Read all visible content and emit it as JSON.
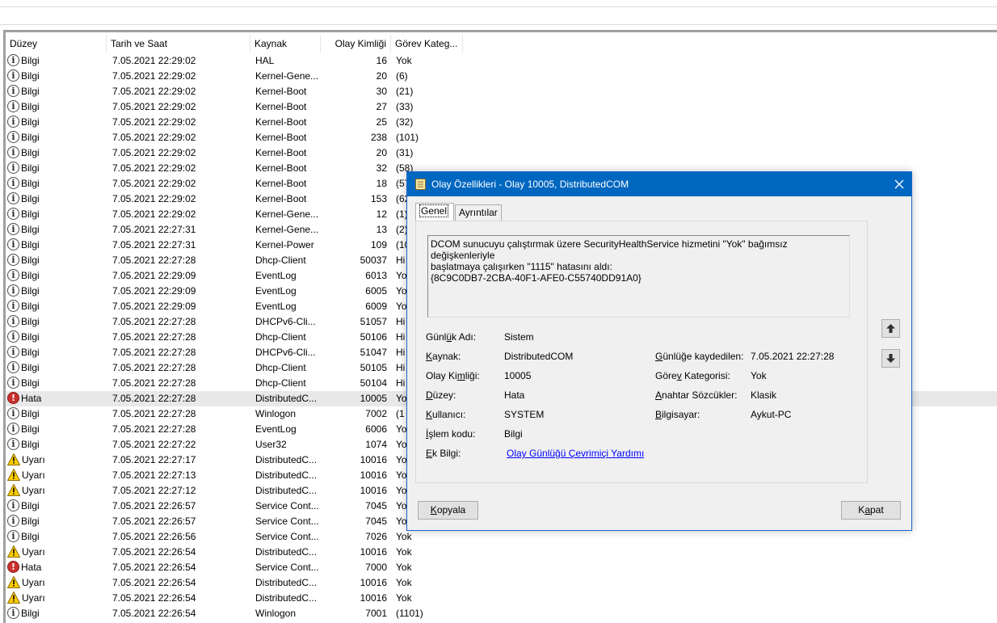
{
  "columns": {
    "level": "Düzey",
    "datetime": "Tarih ve Saat",
    "source": "Kaynak",
    "event_id": "Olay Kimliği",
    "category": "Görev Kateg..."
  },
  "events": [
    {
      "level": "Bilgi",
      "type": "info",
      "datetime": "7.05.2021 22:29:02",
      "source": "HAL",
      "id": "16",
      "category": "Yok"
    },
    {
      "level": "Bilgi",
      "type": "info",
      "datetime": "7.05.2021 22:29:02",
      "source": "Kernel-Gene...",
      "id": "20",
      "category": "(6)"
    },
    {
      "level": "Bilgi",
      "type": "info",
      "datetime": "7.05.2021 22:29:02",
      "source": "Kernel-Boot",
      "id": "30",
      "category": "(21)"
    },
    {
      "level": "Bilgi",
      "type": "info",
      "datetime": "7.05.2021 22:29:02",
      "source": "Kernel-Boot",
      "id": "27",
      "category": "(33)"
    },
    {
      "level": "Bilgi",
      "type": "info",
      "datetime": "7.05.2021 22:29:02",
      "source": "Kernel-Boot",
      "id": "25",
      "category": "(32)"
    },
    {
      "level": "Bilgi",
      "type": "info",
      "datetime": "7.05.2021 22:29:02",
      "source": "Kernel-Boot",
      "id": "238",
      "category": "(101)"
    },
    {
      "level": "Bilgi",
      "type": "info",
      "datetime": "7.05.2021 22:29:02",
      "source": "Kernel-Boot",
      "id": "20",
      "category": "(31)"
    },
    {
      "level": "Bilgi",
      "type": "info",
      "datetime": "7.05.2021 22:29:02",
      "source": "Kernel-Boot",
      "id": "32",
      "category": "(58)"
    },
    {
      "level": "Bilgi",
      "type": "info",
      "datetime": "7.05.2021 22:29:02",
      "source": "Kernel-Boot",
      "id": "18",
      "category": "(57"
    },
    {
      "level": "Bilgi",
      "type": "info",
      "datetime": "7.05.2021 22:29:02",
      "source": "Kernel-Boot",
      "id": "153",
      "category": "(62"
    },
    {
      "level": "Bilgi",
      "type": "info",
      "datetime": "7.05.2021 22:29:02",
      "source": "Kernel-Gene...",
      "id": "12",
      "category": "(1)"
    },
    {
      "level": "Bilgi",
      "type": "info",
      "datetime": "7.05.2021 22:27:31",
      "source": "Kernel-Gene...",
      "id": "13",
      "category": "(2)"
    },
    {
      "level": "Bilgi",
      "type": "info",
      "datetime": "7.05.2021 22:27:31",
      "source": "Kernel-Power",
      "id": "109",
      "category": "(10"
    },
    {
      "level": "Bilgi",
      "type": "info",
      "datetime": "7.05.2021 22:27:28",
      "source": "Dhcp-Client",
      "id": "50037",
      "category": "Hi"
    },
    {
      "level": "Bilgi",
      "type": "info",
      "datetime": "7.05.2021 22:29:09",
      "source": "EventLog",
      "id": "6013",
      "category": "Yo"
    },
    {
      "level": "Bilgi",
      "type": "info",
      "datetime": "7.05.2021 22:29:09",
      "source": "EventLog",
      "id": "6005",
      "category": "Yo"
    },
    {
      "level": "Bilgi",
      "type": "info",
      "datetime": "7.05.2021 22:29:09",
      "source": "EventLog",
      "id": "6009",
      "category": "Yo"
    },
    {
      "level": "Bilgi",
      "type": "info",
      "datetime": "7.05.2021 22:27:28",
      "source": "DHCPv6-Cli...",
      "id": "51057",
      "category": "Hi"
    },
    {
      "level": "Bilgi",
      "type": "info",
      "datetime": "7.05.2021 22:27:28",
      "source": "Dhcp-Client",
      "id": "50106",
      "category": "Hi"
    },
    {
      "level": "Bilgi",
      "type": "info",
      "datetime": "7.05.2021 22:27:28",
      "source": "DHCPv6-Cli...",
      "id": "51047",
      "category": "Hi"
    },
    {
      "level": "Bilgi",
      "type": "info",
      "datetime": "7.05.2021 22:27:28",
      "source": "Dhcp-Client",
      "id": "50105",
      "category": "Hi"
    },
    {
      "level": "Bilgi",
      "type": "info",
      "datetime": "7.05.2021 22:27:28",
      "source": "Dhcp-Client",
      "id": "50104",
      "category": "Hi"
    },
    {
      "level": "Hata",
      "type": "error",
      "datetime": "7.05.2021 22:27:28",
      "source": "DistributedC...",
      "id": "10005",
      "category": "Yo",
      "selected": true
    },
    {
      "level": "Bilgi",
      "type": "info",
      "datetime": "7.05.2021 22:27:28",
      "source": "Winlogon",
      "id": "7002",
      "category": "(1"
    },
    {
      "level": "Bilgi",
      "type": "info",
      "datetime": "7.05.2021 22:27:28",
      "source": "EventLog",
      "id": "6006",
      "category": "Yo"
    },
    {
      "level": "Bilgi",
      "type": "info",
      "datetime": "7.05.2021 22:27:22",
      "source": "User32",
      "id": "1074",
      "category": "Yo"
    },
    {
      "level": "Uyarı",
      "type": "warning",
      "datetime": "7.05.2021 22:27:17",
      "source": "DistributedC...",
      "id": "10016",
      "category": "Yo"
    },
    {
      "level": "Uyarı",
      "type": "warning",
      "datetime": "7.05.2021 22:27:13",
      "source": "DistributedC...",
      "id": "10016",
      "category": "Yo"
    },
    {
      "level": "Uyarı",
      "type": "warning",
      "datetime": "7.05.2021 22:27:12",
      "source": "DistributedC...",
      "id": "10016",
      "category": "Yo"
    },
    {
      "level": "Bilgi",
      "type": "info",
      "datetime": "7.05.2021 22:26:57",
      "source": "Service Cont...",
      "id": "7045",
      "category": "Yo"
    },
    {
      "level": "Bilgi",
      "type": "info",
      "datetime": "7.05.2021 22:26:57",
      "source": "Service Cont...",
      "id": "7045",
      "category": "Yo"
    },
    {
      "level": "Bilgi",
      "type": "info",
      "datetime": "7.05.2021 22:26:56",
      "source": "Service Cont...",
      "id": "7026",
      "category": "Yok"
    },
    {
      "level": "Uyarı",
      "type": "warning",
      "datetime": "7.05.2021 22:26:54",
      "source": "DistributedC...",
      "id": "10016",
      "category": "Yok"
    },
    {
      "level": "Hata",
      "type": "error",
      "datetime": "7.05.2021 22:26:54",
      "source": "Service Cont...",
      "id": "7000",
      "category": "Yok"
    },
    {
      "level": "Uyarı",
      "type": "warning",
      "datetime": "7.05.2021 22:26:54",
      "source": "DistributedC...",
      "id": "10016",
      "category": "Yok"
    },
    {
      "level": "Uyarı",
      "type": "warning",
      "datetime": "7.05.2021 22:26:54",
      "source": "DistributedC...",
      "id": "10016",
      "category": "Yok"
    },
    {
      "level": "Bilgi",
      "type": "info",
      "datetime": "7.05.2021 22:26:54",
      "source": "Winlogon",
      "id": "7001",
      "category": "(1101)"
    }
  ],
  "dialog": {
    "title": "Olay Özellikleri - Olay 10005, DistributedCOM",
    "tabs": [
      "Genel",
      "Ayrıntılar"
    ],
    "description": "DCOM sunucuyu çalıştırmak üzere SecurityHealthService hizmetini \"Yok\" bağımsız değişkenleriyle\nbaşlatmaya çalışırken \"1115\" hatasını aldı:\n{8C9C0DB7-2CBA-40F1-AFE0-C55740DD91A0}",
    "labels": {
      "log_name": "Günlük Adı:",
      "source": "Kaynak:",
      "event_id": "Olay Kimliği:",
      "level": "Düzey:",
      "user": "Kullanıcı:",
      "opcode": "İşlem kodu:",
      "more_info": "Ek Bilgi:",
      "logged": "Günlüğe kaydedilen:",
      "task_category": "Görev Kategorisi:",
      "keywords": "Anahtar Sözcükler:",
      "computer": "Bilgisayar:"
    },
    "values": {
      "log_name": "Sistem",
      "source": "DistributedCOM",
      "event_id": "10005",
      "level": "Hata",
      "user": "SYSTEM",
      "opcode": "Bilgi",
      "more_info_link": "Olay Günlüğü Çevrimiçi Yardımı",
      "logged": "7.05.2021 22:27:28",
      "task_category": "Yok",
      "keywords": "Klasik",
      "computer": "Aykut-PC"
    },
    "buttons": {
      "copy": "Kopyala",
      "close": "Kapat"
    }
  },
  "colors": {
    "titlebar": "#0067c0",
    "error": "#c9302c",
    "warning": "#ffcc00",
    "link": "#0000ff"
  }
}
